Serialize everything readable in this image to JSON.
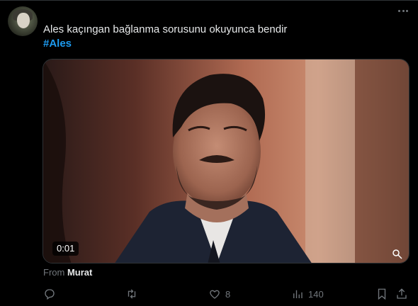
{
  "tweet": {
    "author_name": "",
    "text": "Ales kaçıngan bağlanma sorusunu okuyunca bendir",
    "hashtag": "#Ales"
  },
  "media": {
    "duration": "0:01",
    "from_prefix": "From",
    "from_name": "Murat"
  },
  "actions": {
    "reply_count": "",
    "retweet_count": "",
    "like_count": "8",
    "view_count": "140"
  },
  "icons": [
    "more-icon",
    "reply-icon",
    "retweet-icon",
    "like-icon",
    "views-icon",
    "bookmark-icon",
    "share-icon",
    "gif-icon"
  ],
  "colors": {
    "background": "#000000",
    "text": "#e7e9ea",
    "muted": "#71767b",
    "link": "#1d9bf0"
  }
}
